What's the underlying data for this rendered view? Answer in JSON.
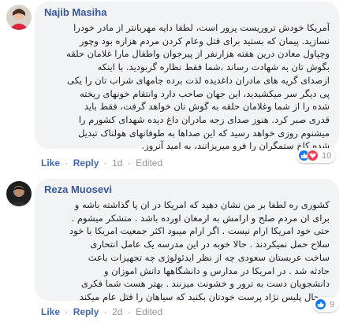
{
  "colors": {
    "bubble_bg": "#f2f3f5",
    "author": "#385898",
    "link": "#4267b2",
    "meta": "#90949c",
    "like_blue": "#1877f2",
    "love_red": "#f33e58"
  },
  "comments": [
    {
      "author": "Najib Masiha",
      "avatar_icon": "profile-photo-woman-red-top",
      "lines": [
        "آمریکا خودش تروریست پرور است، لطفا دایه مهربانتر از مادر خودرا",
        "نسازید. پیمان که بستید برای قتل وعام کردن مردم هزاره بود وچور",
        "وچپاول معادن درین هفته هزارنفر از پیرجوان واطفال مارا غلامان حلقه",
        "بگوش تان به شهادت رساند ،شما فقط نظاره گربودید. با اینکه",
        "ازصدای گریه های مادران داغدیده لذت برده جامهای شراب تان را یکی",
        "پی دیگر سر میکشیدید، این جهان صاحب دارد وانتقام خونهای ریخته",
        "شده را از شما وغلامان حلقه به گوش تان خواهد گرفت، فقط باید",
        "قدری صبر کرد. هنوز صدای زجه مادران داغ دیده شهدای کشورم را",
        "میشنوم روزی خواهد رسید که این صداها به طوفانهای هولناک تبدیل",
        "شده کاخ ستمگران را فرو میریزانند، به امید آنروز."
      ],
      "actions": {
        "like": "Like",
        "reply": "Reply",
        "time": "1d",
        "edited": "Edited",
        "separator": "·"
      },
      "reactions": {
        "icons": [
          "like-icon",
          "love-icon"
        ],
        "count": "10"
      }
    },
    {
      "author": "Reza Muosevi",
      "avatar_icon": "profile-photo-man-dark",
      "lines": [
        "کشوری ره لطفا بر من نشان دهید که امریکا در ان پا گذاشته باشه و",
        "برای ان مردم صلح و ارامش به ارمغان اورده باشد . متشکر میشوم .",
        "حتی خود امریکا ارام نیست . اگر ارام میبود اکثر جمعیت امریکا با خود",
        "سلاح حمل نمیکردند . حالا خوبه در این مدرسه یک عامل انتحاری",
        "ساخت عربستان سعودی چه از نظر ایدئولوژی چه تجهیزات باعث",
        "حادثه شد . در امریکا در مدارس و دانشگاهها دانش اموزان و",
        "دانشجویان دست به ترور و خشونت میزنند . بهتر هست شما فکری",
        "به حال پلیس نژاد پرست خودتان بکنید که سیاهان را قتل عام میکند"
      ],
      "actions": {
        "like": "Like",
        "reply": "Reply",
        "time": "2d",
        "edited": "Edited",
        "separator": "·"
      },
      "reactions": {
        "icons": [
          "like-icon"
        ],
        "count": "9"
      }
    }
  ]
}
